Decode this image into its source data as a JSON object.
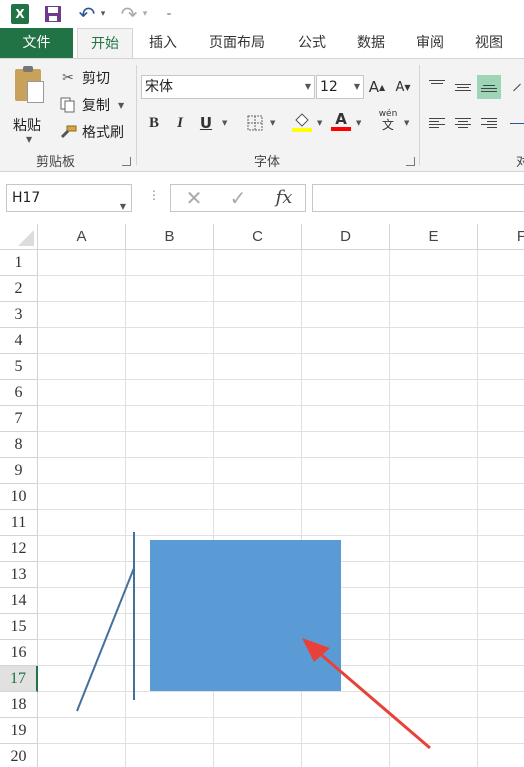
{
  "qat": {
    "app_icon_letter": "X",
    "undo_glyph": "↶",
    "redo_glyph": "↷",
    "dropdown_glyph": "▾",
    "customize_glyph": "₌"
  },
  "tabs": [
    {
      "label": "文件"
    },
    {
      "label": "开始"
    },
    {
      "label": "插入"
    },
    {
      "label": "页面布局"
    },
    {
      "label": "公式"
    },
    {
      "label": "数据"
    },
    {
      "label": "审阅"
    },
    {
      "label": "视图"
    }
  ],
  "clipboard": {
    "paste_label": "粘贴",
    "cut_label": "剪切",
    "copy_label": "复制",
    "format_painter_label": "格式刷",
    "group_label": "剪贴板"
  },
  "font": {
    "font_name": "宋体",
    "font_size": "12",
    "grow_label": "A",
    "shrink_label": "A",
    "bold_label": "B",
    "italic_label": "I",
    "underline_label": "U",
    "font_color_label": "A",
    "phonetic_label": "wén",
    "group_label": "字体",
    "fill_color": "#ffff00",
    "font_color": "#ff0000"
  },
  "alignment": {
    "group_label_partial": "对"
  },
  "formula_bar": {
    "name_box": "H17",
    "cancel_glyph": "✕",
    "enter_glyph": "✓",
    "fx_label": "fx",
    "formula": ""
  },
  "sheet": {
    "columns": [
      "A",
      "B",
      "C",
      "D",
      "E",
      "F"
    ],
    "rows": [
      "1",
      "2",
      "3",
      "4",
      "5",
      "6",
      "7",
      "8",
      "9",
      "10",
      "11",
      "12",
      "13",
      "14",
      "15",
      "16",
      "17",
      "18",
      "19",
      "20"
    ],
    "selected_row": "17",
    "shape_fill": "#5b9bd5",
    "line_color": "#41719c",
    "arrow_color": "#e8413a"
  },
  "colors": {
    "accent": "#217346",
    "ribbon_bg": "#f3f3f3"
  }
}
